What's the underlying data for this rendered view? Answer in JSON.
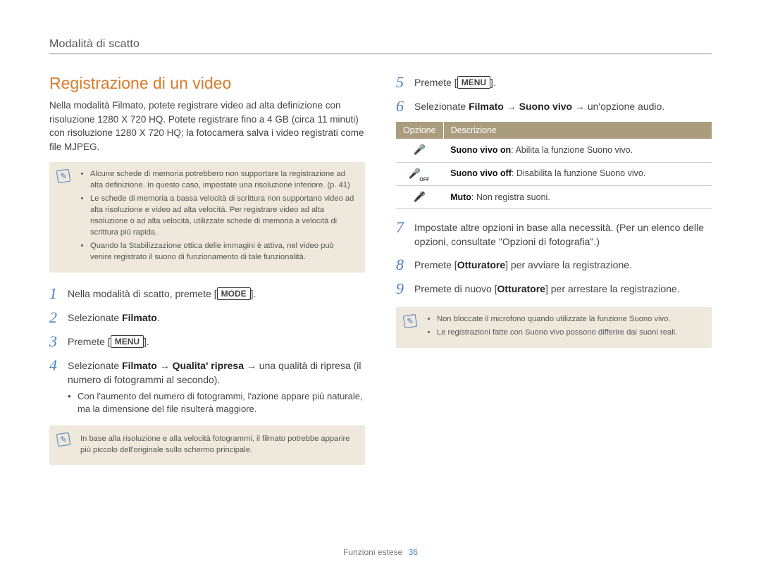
{
  "breadcrumb": "Modalità di scatto",
  "section_title": "Registrazione di un video",
  "intro": "Nella modalità Filmato, potete registrare video ad alta definizione con risoluzione 1280 X 720 HQ. Potete registrare fino a 4 GB (circa 11 minuti) con risoluzione 1280 X 720 HQ; la fotocamera salva i video registrati come file MJPEG.",
  "note1": {
    "items": [
      "Alcune schede di memoria potrebbero non supportare la registrazione ad alta definizione. In questo caso, impostate una risoluzione inferiore. (p. 41)",
      "Le schede di memoria a bassa velocità di scrittura non supportano video ad alta risoluzione e video ad alta velocità. Per registrare video ad alta risoluzione o ad alta velocità, utilizzate schede di memoria a velocità di scrittura più rapida.",
      "Quando la Stabilizzazione ottica delle immagini è attiva, nel video può venire registrato il suono di funzionamento di tale funzionalità."
    ]
  },
  "steps_left": [
    {
      "num": "1",
      "pre": "Nella modalità di scatto, premete [",
      "btn": "MODE",
      "post": "]."
    },
    {
      "num": "2",
      "html": "Selezionate <b>Filmato</b>."
    },
    {
      "num": "3",
      "pre": "Premete [",
      "btn": "MENU",
      "post": "]."
    },
    {
      "num": "4",
      "html": "Selezionate <b>Filmato</b> → <b>Qualita' ripresa</b> → una qualità di ripresa (il numero di fotogrammi al secondo).",
      "sub": "Con l'aumento del numero di fotogrammi, l'azione appare più naturale, ma la dimensione del file risulterà maggiore."
    }
  ],
  "note2": "In base alla risoluzione e alla velocità fotogrammi, il filmato potrebbe apparire più piccolo dell'originale sullo schermo principale.",
  "steps_right_top": [
    {
      "num": "5",
      "pre": "Premete [",
      "btn": "MENU",
      "post": "]."
    },
    {
      "num": "6",
      "html": "Selezionate <b>Filmato</b> → <b>Suono vivo</b> → un'opzione audio."
    }
  ],
  "table": {
    "head": {
      "col1": "Opzione",
      "col2": "Descrizione"
    },
    "rows": [
      {
        "icon": "mic-on",
        "label": "Suono vivo on",
        "desc": "Abilita la funzione Suono vivo."
      },
      {
        "icon": "mic-off",
        "label": "Suono vivo off",
        "desc": "Disabilita la funzione Suono vivo."
      },
      {
        "icon": "mic-mute",
        "label": "Muto",
        "desc": "Non registra suoni."
      }
    ]
  },
  "steps_right_bottom": [
    {
      "num": "7",
      "html": "Impostate altre opzioni in base alla necessità. (Per un elenco delle opzioni, consultate \"Opzioni di fotografia\".)"
    },
    {
      "num": "8",
      "html": "Premete [<b>Otturatore</b>] per avviare la registrazione."
    },
    {
      "num": "9",
      "html": "Premete di nuovo [<b>Otturatore</b>] per arrestare la registrazione."
    }
  ],
  "note3": {
    "items": [
      "Non bloccate il microfono quando utilizzate la funzione Suono vivo.",
      "Le registrazioni fatte con Suono vivo possono differire dai suoni reali."
    ]
  },
  "footer": {
    "label": "Funzioni estese",
    "page": "36"
  }
}
